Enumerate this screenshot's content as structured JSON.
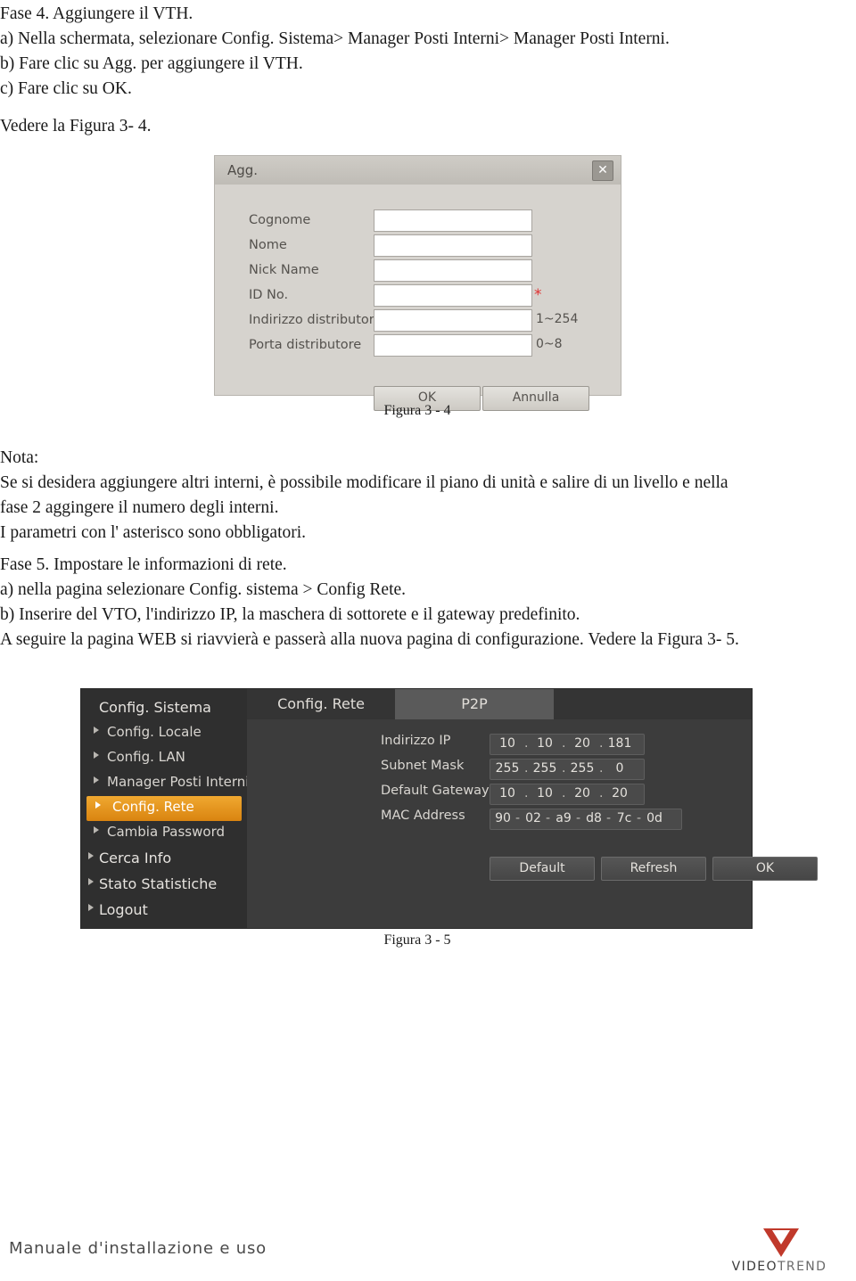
{
  "top_text": {
    "lines": [
      "Fase 4. Aggiungere il VTH.",
      "a) Nella schermata, selezionare Config. Sistema> Manager Posti Interni> Manager Posti Interni.",
      "b) Fare clic su Agg. per aggiungere il VTH.",
      "c) Fare clic su OK.",
      "Vedere la Figura 3- 4."
    ]
  },
  "figure_34_caption": "Figura 3 - 4",
  "figure_35_caption": "Figura 3 - 5",
  "mid_text": {
    "lines": [
      "Nota:",
      "Se si desidera aggiungere altri interni, è possibile modificare il piano di unità e salire di un livello e nella",
      "fase 2 aggingere il numero degli interni.",
      "I parametri con l' asterisco sono obbligatori.",
      "Fase 5. Impostare le informazioni di rete.",
      "a) nella pagina selezionare Config. sistema > Config Rete.",
      "b) Inserire del VTO, l'indirizzo IP, la maschera di sottorete e il gateway predefinito.",
      "A seguire la pagina WEB si riavvierà e passerà alla nuova pagina di configurazione. Vedere la Figura 3- 5."
    ]
  },
  "dialog_agg": {
    "title": "Agg.",
    "close_icon": "✕",
    "fields": [
      {
        "label": "Cognome",
        "value": "",
        "hint": "",
        "required": false
      },
      {
        "label": "Nome",
        "value": "",
        "hint": "",
        "required": false
      },
      {
        "label": "Nick Name",
        "value": "",
        "hint": "",
        "required": false
      },
      {
        "label": "ID No.",
        "value": "",
        "hint": "",
        "required": true
      },
      {
        "label": "Indirizzo distributore",
        "value": "",
        "hint": "1~254",
        "required": false
      },
      {
        "label": "Porta distributore",
        "value": "",
        "hint": "0~8",
        "required": false
      }
    ],
    "buttons": {
      "ok": "OK",
      "cancel": "Annulla"
    }
  },
  "config_window": {
    "sidebar": [
      {
        "label": "Config. Sistema",
        "type": "head",
        "selected": false
      },
      {
        "label": "Config. Locale",
        "type": "item",
        "selected": false
      },
      {
        "label": "Config. LAN",
        "type": "item",
        "selected": false
      },
      {
        "label": "Manager Posti Interni",
        "type": "item",
        "selected": false
      },
      {
        "label": "Config. Rete",
        "type": "item",
        "selected": true
      },
      {
        "label": "Cambia Password",
        "type": "item",
        "selected": false
      },
      {
        "label": "Cerca Info",
        "type": "head-small",
        "selected": false
      },
      {
        "label": "Stato Statistiche",
        "type": "head-small",
        "selected": false
      },
      {
        "label": "Logout",
        "type": "head-small",
        "selected": false
      }
    ],
    "tabs": [
      {
        "label": "Config. Rete",
        "active": true
      },
      {
        "label": "P2P",
        "active": false
      }
    ],
    "fields": [
      {
        "label": "Indirizzo IP",
        "segments": [
          "10",
          "10",
          "20",
          "181"
        ],
        "separator": "."
      },
      {
        "label": "Subnet Mask",
        "segments": [
          "255",
          "255",
          "255",
          "0"
        ],
        "separator": "."
      },
      {
        "label": "Default Gateway",
        "segments": [
          "10",
          "10",
          "20",
          "20"
        ],
        "separator": "."
      },
      {
        "label": "MAC Address",
        "segments": [
          "90",
          "02",
          "a9",
          "d8",
          "7c",
          "0d"
        ],
        "separator": "-"
      }
    ],
    "buttons": {
      "default": "Default",
      "refresh": "Refresh",
      "ok": "OK"
    }
  },
  "footer": {
    "manual_text": "Manuale d'installazione e uso",
    "brand_main": "VIDEO",
    "brand_sub": "TREND"
  }
}
